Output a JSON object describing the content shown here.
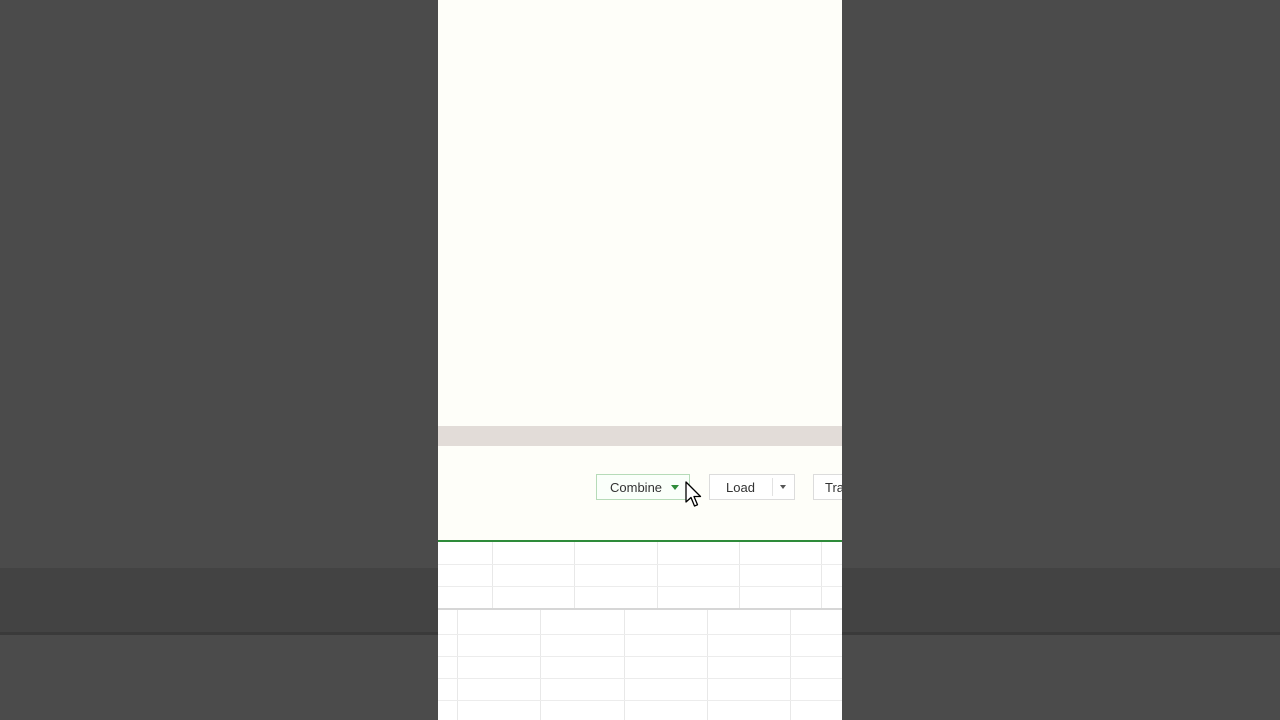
{
  "footer": {
    "combine_label": "Combine",
    "load_label": "Load",
    "transform_label": "Tra"
  },
  "icons": {
    "combine_caret": "chevron-down-icon",
    "load_caret": "chevron-down-icon",
    "cursor": "mouse-pointer-icon"
  },
  "colors": {
    "accent": "#2e8b3a",
    "backdrop": "#4b4b4b",
    "dialog_bg": "#fefef9",
    "separator": "#e2dcd8"
  }
}
